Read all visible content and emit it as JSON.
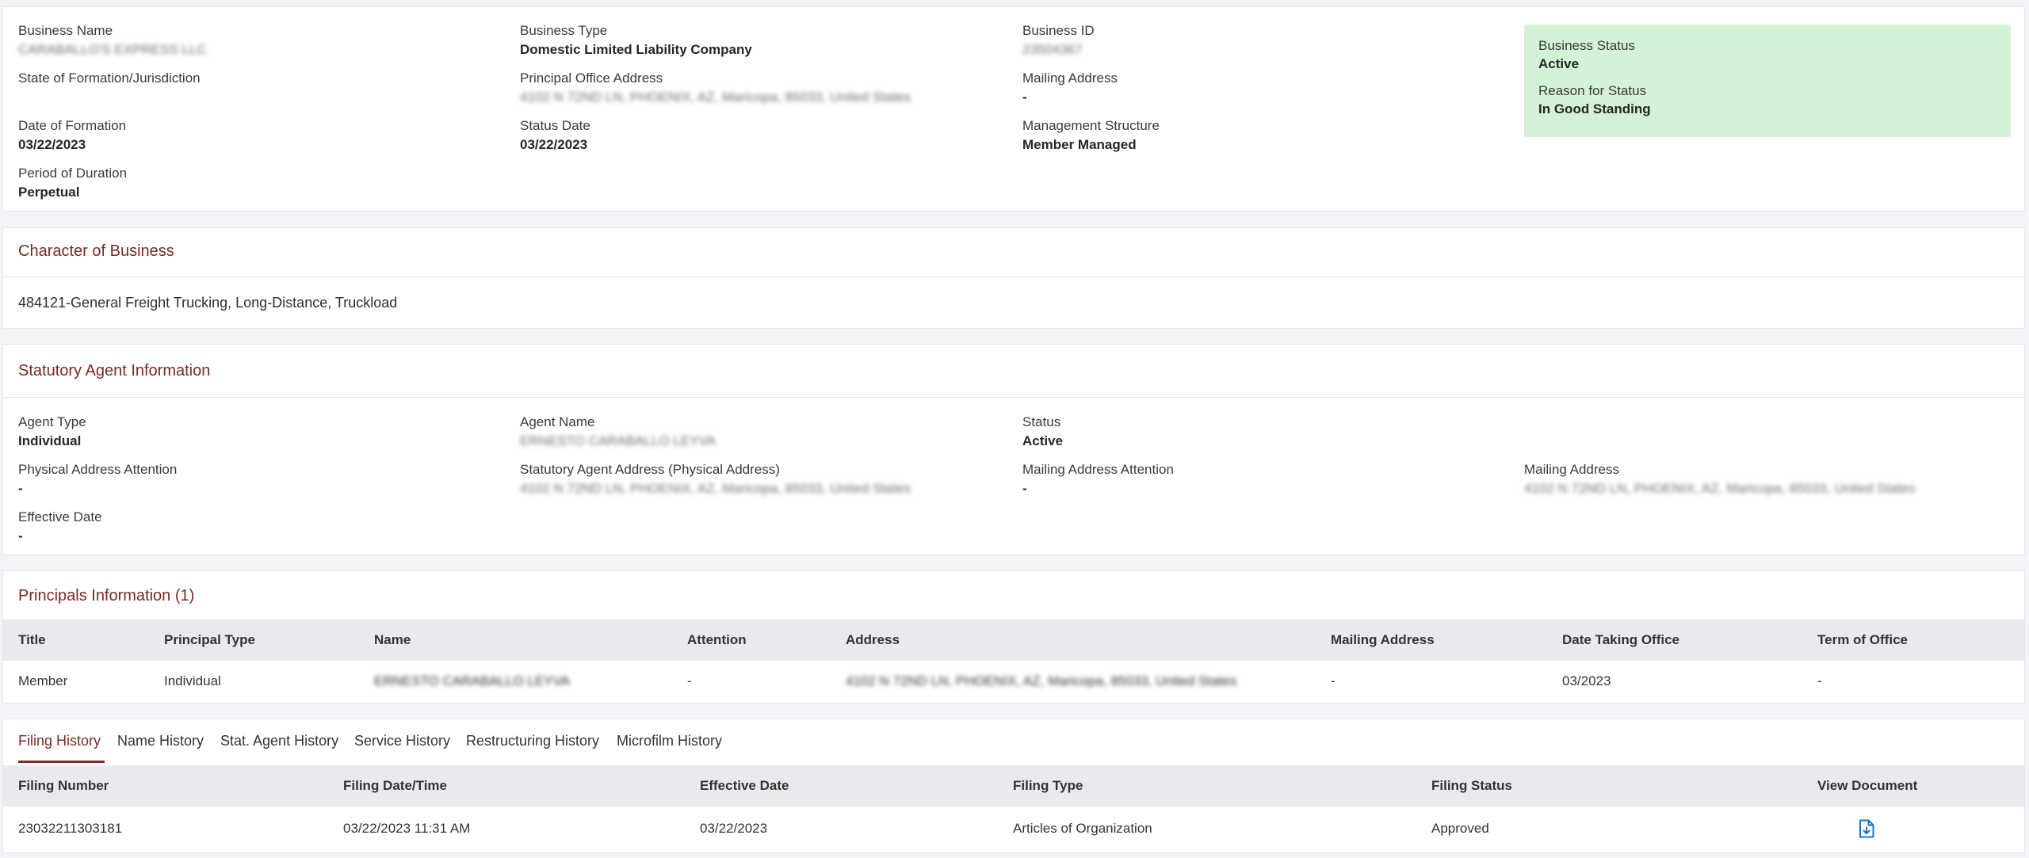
{
  "summary": {
    "business_name_label": "Business Name",
    "business_name_value": "CARABALLO'S EXPRESS LLC",
    "business_type_label": "Business Type",
    "business_type_value": "Domestic Limited Liability Company",
    "business_id_label": "Business ID",
    "business_id_value": "23504367",
    "state_label": "State of Formation/Jurisdiction",
    "principal_office_label": "Principal Office Address",
    "principal_office_value": "4102 N 72ND LN, PHOENIX, AZ, Maricopa, 85033, United States",
    "mailing_label": "Mailing Address",
    "mailing_value": "-",
    "formation_date_label": "Date of Formation",
    "formation_date_value": "03/22/2023",
    "status_date_label": "Status Date",
    "status_date_value": "03/22/2023",
    "management_label": "Management Structure",
    "management_value": "Member Managed",
    "duration_label": "Period of Duration",
    "duration_value": "Perpetual",
    "status_box": {
      "status_label": "Business Status",
      "status_value": "Active",
      "reason_label": "Reason for Status",
      "reason_value": "In Good Standing",
      "color": "#d4f2d6"
    }
  },
  "character": {
    "title": "Character of Business",
    "value": "484121-General Freight Trucking, Long-Distance, Truckload"
  },
  "agent": {
    "title": "Statutory Agent Information",
    "agent_type_label": "Agent Type",
    "agent_type_value": "Individual",
    "agent_name_label": "Agent Name",
    "agent_name_value": "ERNESTO CARABALLO LEYVA",
    "status_label": "Status",
    "status_value": "Active",
    "physical_attention_label": "Physical Address Attention",
    "physical_attention_value": "-",
    "physical_address_label": "Statutory Agent Address (Physical Address)",
    "physical_address_value": "4102 N 72ND LN, PHOENIX, AZ, Maricopa, 85033, United States",
    "mailing_attention_label": "Mailing Address Attention",
    "mailing_attention_value": "-",
    "mailing_address_label": "Mailing Address",
    "mailing_address_value": "4102 N 72ND LN, PHOENIX, AZ, Maricopa, 85033, United States",
    "effective_date_label": "Effective Date",
    "effective_date_value": "-"
  },
  "principals": {
    "title": "Principals Information (1)",
    "columns": [
      "Title",
      "Principal Type",
      "Name",
      "Attention",
      "Address",
      "Mailing Address",
      "Date Taking Office",
      "Term of Office"
    ],
    "rows": [
      [
        "Member",
        "Individual",
        "ERNESTO CARABALLO LEYVA",
        "-",
        "4102 N 72ND LN, PHOENIX, AZ, Maricopa, 85033, United States",
        "-",
        "03/2023",
        "-"
      ]
    ]
  },
  "history": {
    "tabs": [
      "Filing History",
      "Name History",
      "Stat. Agent History",
      "Service History",
      "Restructuring History",
      "Microfilm History"
    ],
    "active_tab": "Filing History",
    "columns": [
      "Filing Number",
      "Filing Date/Time",
      "Effective Date",
      "Filing Type",
      "Filing Status",
      "View Document"
    ],
    "rows": [
      [
        "23032211303181",
        "03/22/2023 11:31 AM",
        "03/22/2023",
        "Articles of Organization",
        "Approved"
      ]
    ],
    "view_icon": "document-download-icon"
  },
  "colors": {
    "accent": "#7a2a22",
    "status_green": "#d4f2d6",
    "icon_blue": "#1a73c8"
  }
}
